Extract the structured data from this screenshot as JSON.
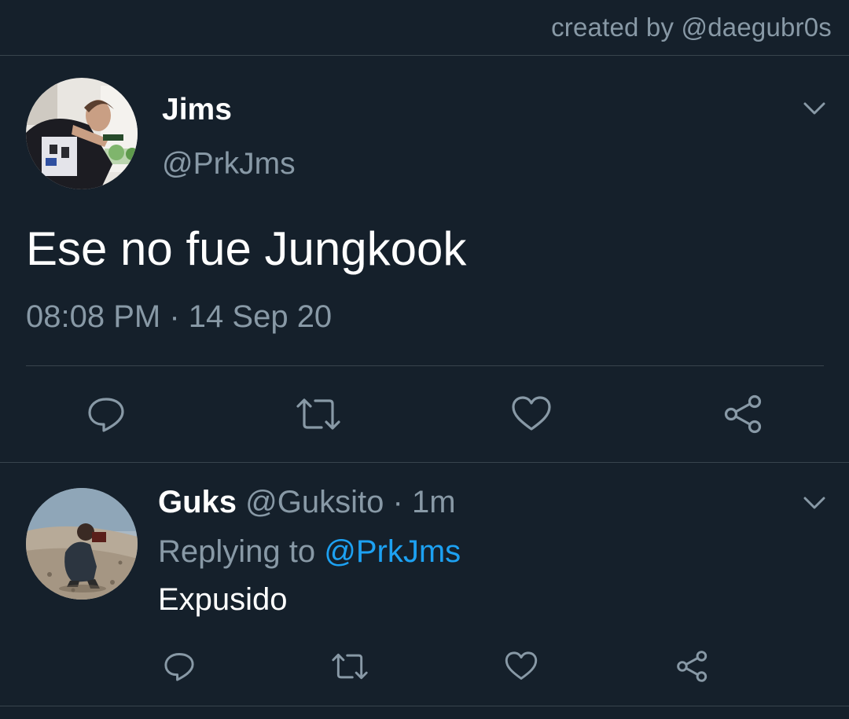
{
  "credit": "created by @daegubr0s",
  "tweet": {
    "name": "Jims",
    "handle": "@PrkJms",
    "text": "Ese no fue Jungkook",
    "time": "08:08 PM",
    "separator": "·",
    "date": "14 Sep 20"
  },
  "reply": {
    "name": "Guks",
    "handle": "@Guksito",
    "separator": "·",
    "age": "1m",
    "replying_prefix": "Replying to",
    "replying_to": "@PrkJms",
    "text": "Expusido"
  },
  "icons": {
    "reply": "speech-bubble-icon",
    "retweet": "retweet-icon",
    "like": "heart-icon",
    "share": "share-icon",
    "more": "chevron-down-icon"
  },
  "colors": {
    "background": "#15202b",
    "border": "#38444d",
    "primary_text": "#ffffff",
    "secondary_text": "#8899a6",
    "accent": "#1da1f2"
  }
}
